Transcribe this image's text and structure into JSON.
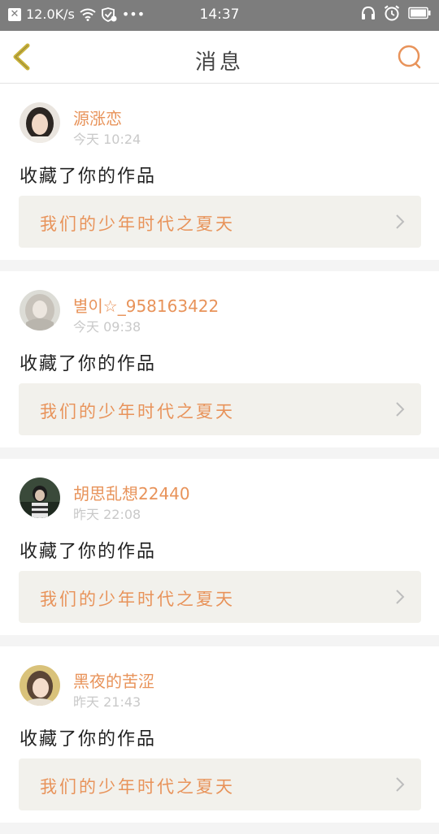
{
  "status_bar": {
    "speed": "12.0K/s",
    "dots": "•••",
    "time": "14:37",
    "notify_glyph": "✕"
  },
  "header": {
    "title": "消息"
  },
  "messages": [
    {
      "user": "源涨恋",
      "time": "今天 10:24",
      "action": "收藏了你的作品",
      "work": "我们的少年时代之夏天"
    },
    {
      "user": "별이☆_958163422",
      "time": "今天 09:38",
      "action": "收藏了你的作品",
      "work": "我们的少年时代之夏天"
    },
    {
      "user": "胡思乱想22440",
      "time": "昨天 22:08",
      "action": "收藏了你的作品",
      "work": "我们的少年时代之夏天"
    },
    {
      "user": "黑夜的苦涩",
      "time": "昨天 21:43",
      "action": "收藏了你的作品",
      "work": "我们的少年时代之夏天"
    }
  ],
  "colors": {
    "accent": "#e8935a",
    "back_arrow": "#c9b23a",
    "work_bg": "#f2f1ec"
  }
}
